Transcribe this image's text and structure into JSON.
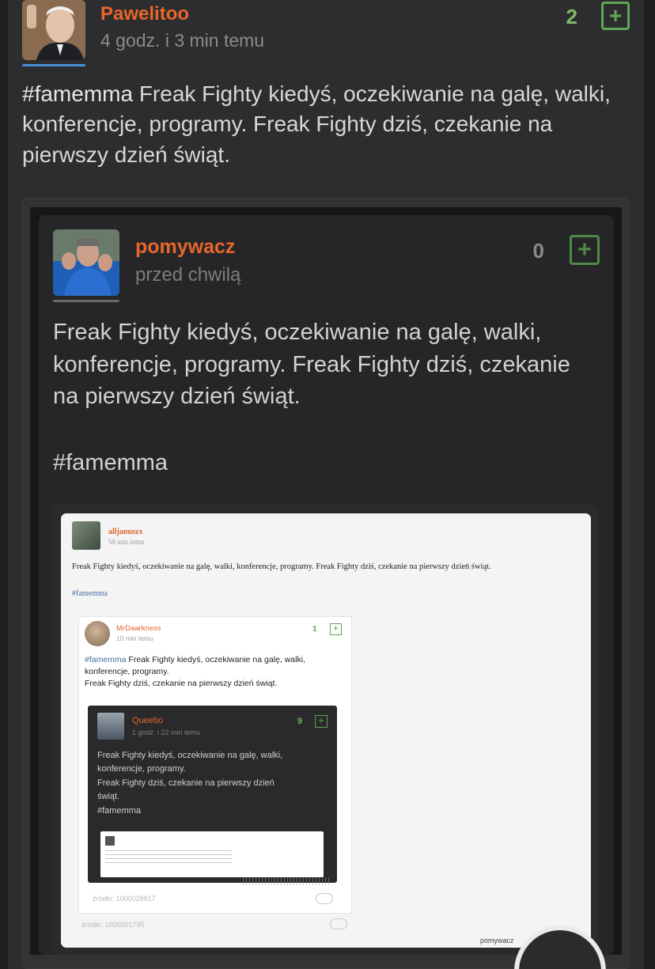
{
  "post": {
    "username": "Pawelitoo",
    "time": "4 godz. i 3 min temu",
    "votes": "2",
    "plus_glyph": "+",
    "tag": "#famemma",
    "text": " Freak Fighty kiedyś, oczekiwanie na galę, walki, konferencje, programy. Freak Fighty dziś, czekanie na pierwszy dzień świąt."
  },
  "embed": {
    "username": "pomywacz",
    "time": "przed chwilą",
    "votes": "0",
    "plus_glyph": "+",
    "text": "Freak Fighty kiedyś, oczekiwanie na galę, walki, konferencje, programy. Freak Fighty dziś, czekanie na pierwszy dzień świąt.",
    "tag": "#famemma"
  },
  "screenshot": {
    "l1": {
      "username": "alljanuszx",
      "time": "58 min temu",
      "text": "Freak Fighty kiedyś, oczekiwanie na galę, walki, konferencje, programy. Freak Fighty dziś, czekanie na pierwszy dzień świąt.",
      "tag": "#famemma",
      "source": "źródło: 1000001795",
      "footer": "pomywacz"
    },
    "l2": {
      "username": "MrDaarkness",
      "time": "10 min temu",
      "votes": "1",
      "tag": "#famemma",
      "text_a": " Freak Fighty kiedyś, oczekiwanie na galę, walki,",
      "text_b": "konferencje, programy.",
      "text_c": "Freak Fighty dziś, czekanie na pierwszy dzień świąt.",
      "source": "źródło: 1000028817"
    },
    "l3": {
      "username": "Queebo",
      "time": "1 godz. i 22 min temu",
      "votes": "9",
      "text_a": "Freak Fighty kiedyś, oczekiwanie na galę, walki,",
      "text_b": "konferencje, programy.",
      "text_c": "Freak Fighty dziś, czekanie na pierwszy dzień",
      "text_d": "świąt.",
      "tag": "#famemma"
    }
  },
  "colors": {
    "accent_username": "#e8662a",
    "vote_green": "#7fb86a",
    "background": "#1f1f21"
  }
}
